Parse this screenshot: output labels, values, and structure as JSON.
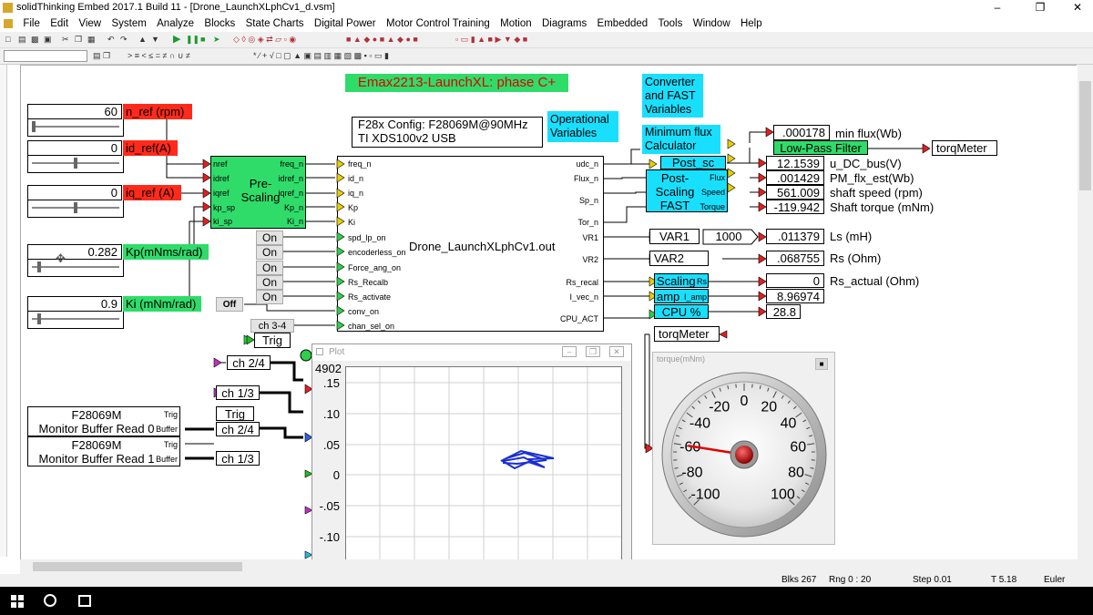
{
  "window": {
    "title": "solidThinking Embed 2017.1 Build 11 - [Drone_LaunchXLphCv1_d.vsm]"
  },
  "menu": [
    "File",
    "Edit",
    "View",
    "System",
    "Analyze",
    "Blocks",
    "State Charts",
    "Digital Power",
    "Motor Control Training",
    "Motion",
    "Diagrams",
    "Embedded",
    "Tools",
    "Window",
    "Help"
  ],
  "diagram": {
    "title": "Emax2213-LaunchXL: phase C+",
    "config_line1": "F28x Config: F28069M@90MHz",
    "config_line2": "TI XDS100v2 USB",
    "op_vars": "Operational Variables",
    "conv_vars": "Converter and FAST Variables",
    "minflux": "Minimum flux Calculator",
    "lpf": "Low-Pass Filter",
    "torqmeter": "torqMeter",
    "n_ref": {
      "value": "60",
      "label": "n_ref (rpm)"
    },
    "id_ref": {
      "value": "0",
      "label": "id_ref(A)"
    },
    "iq_ref": {
      "value": "0",
      "label": "iq_ref (A)"
    },
    "kp": {
      "value": "0.282",
      "label": "Kp(mNms/rad)"
    },
    "ki": {
      "value": "0.9",
      "label": "Ki (mNm/rad)"
    },
    "prescaling": {
      "label": "Pre-Scaling",
      "in": [
        "nref",
        "idref",
        "iqref",
        "kp_sp",
        "ki_sp"
      ],
      "out": [
        "freq_n",
        "idref_n",
        "iqref_n",
        "Kp_n",
        "Ki_n"
      ]
    },
    "on_buttons": [
      "On",
      "On",
      "On",
      "On",
      "On"
    ],
    "off_button": "Off",
    "main_block": {
      "name": "Drone_LaunchXLphCv1.out",
      "inputs": [
        "freq_n",
        "id_n",
        "iq_n",
        "Kp",
        "Ki",
        "spd_lp_on",
        "encoderless_on",
        "Force_ang_on",
        "Rs_Recalb",
        "Rs_activate",
        "conv_on",
        "chan_sel_on"
      ],
      "outputs": [
        "udc_n",
        "Flux_n",
        "Sp_n",
        "Tor_n",
        "VR1",
        "VR2",
        "Rs_recal",
        "I_vec_n",
        "CPU_ACT"
      ]
    },
    "post_sc": "Post_sc",
    "post_fast": {
      "label": "Post-Scaling FAST",
      "ports": [
        "Flux",
        "Speed",
        "Torque"
      ]
    },
    "var1": "VAR1",
    "var2": "VAR2",
    "gain": "1000",
    "scaling": "Scaling",
    "scaling_port": "Rs",
    "amp": "amp",
    "amp_port": "I_amp",
    "cpu": "CPU %",
    "readouts": [
      {
        "value": ".000178",
        "label": "min flux(Wb)"
      },
      {
        "value": "12.1539",
        "label": "u_DC_bus(V)"
      },
      {
        "value": ".001429",
        "label": "PM_flx_est(Wb)"
      },
      {
        "value": "561.009",
        "label": "shaft speed (rpm)"
      },
      {
        "value": "-119.942",
        "label": "Shaft torque (mNm)"
      },
      {
        "value": ".011379",
        "label": "Ls (mH)"
      },
      {
        "value": ".068755",
        "label": "Rs (Ohm)"
      },
      {
        "value": "0",
        "label": "Rs_actual (Ohm)"
      },
      {
        "value": "8.96974",
        "label": ""
      },
      {
        "value": "28.8",
        "label": ""
      }
    ],
    "ch34": "ch 3-4",
    "trig": "Trig",
    "ch24": "ch 2/4",
    "ch13": "ch 1/3",
    "monitor0": {
      "line1": "F28069M",
      "line2": "Monitor Buffer Read 0",
      "p1": "Trig",
      "p2": "Buffer"
    },
    "monitor1": {
      "line1": "F28069M",
      "line2": "Monitor Buffer Read 1",
      "p1": "Trig",
      "p2": "Buffer"
    }
  },
  "plot": {
    "title": "Plot",
    "top_label": "4902",
    "yticks": [
      ".15",
      ".10",
      ".05",
      "0",
      "-.05",
      "-.10"
    ]
  },
  "gauge": {
    "title": "torque(mNm)",
    "labels": [
      "-100",
      "-80",
      "-60",
      "-40",
      "-20",
      "0",
      "20",
      "40",
      "60",
      "80",
      "100"
    ],
    "value": -60
  },
  "status": {
    "blks": "Blks  267",
    "rng": "Rng  0 : 20",
    "step": "Step  0.01",
    "t": "T  5.18",
    "solver": "Euler"
  }
}
